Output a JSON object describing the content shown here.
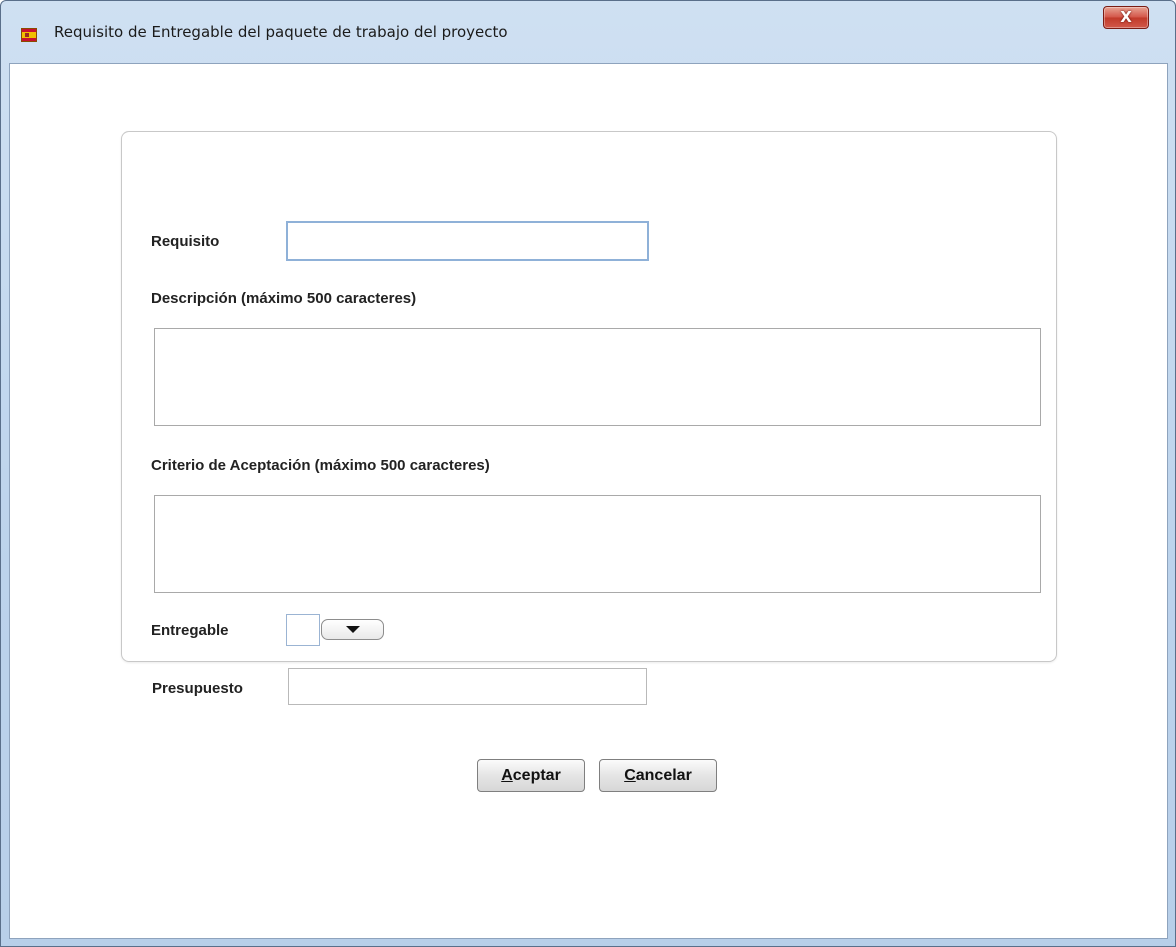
{
  "window": {
    "title": "Requisito de Entregable del paquete de trabajo del proyecto",
    "close_label": "X"
  },
  "form": {
    "requisito_label": "Requisito",
    "requisito_value": "",
    "descripcion_label": "Descripción (máximo 500 caracteres)",
    "descripcion_value": "",
    "criterio_label": "Criterio de Aceptación (máximo 500 caracteres)",
    "criterio_value": "",
    "entregable_label": "Entregable",
    "entregable_value": "",
    "presupuesto_label": "Presupuesto",
    "presupuesto_value": ""
  },
  "buttons": {
    "aceptar_mnemonic": "A",
    "aceptar_rest": "ceptar",
    "cancelar_mnemonic": "C",
    "cancelar_rest": "ancelar"
  },
  "icons": {
    "app": "spain-flag-icon",
    "close": "close-icon",
    "dropdown": "chevron-down-icon"
  },
  "colors": {
    "title_gradient": "#bcd3ec",
    "close_button": "#c13a2a",
    "focus_border": "#8fb1d8"
  }
}
